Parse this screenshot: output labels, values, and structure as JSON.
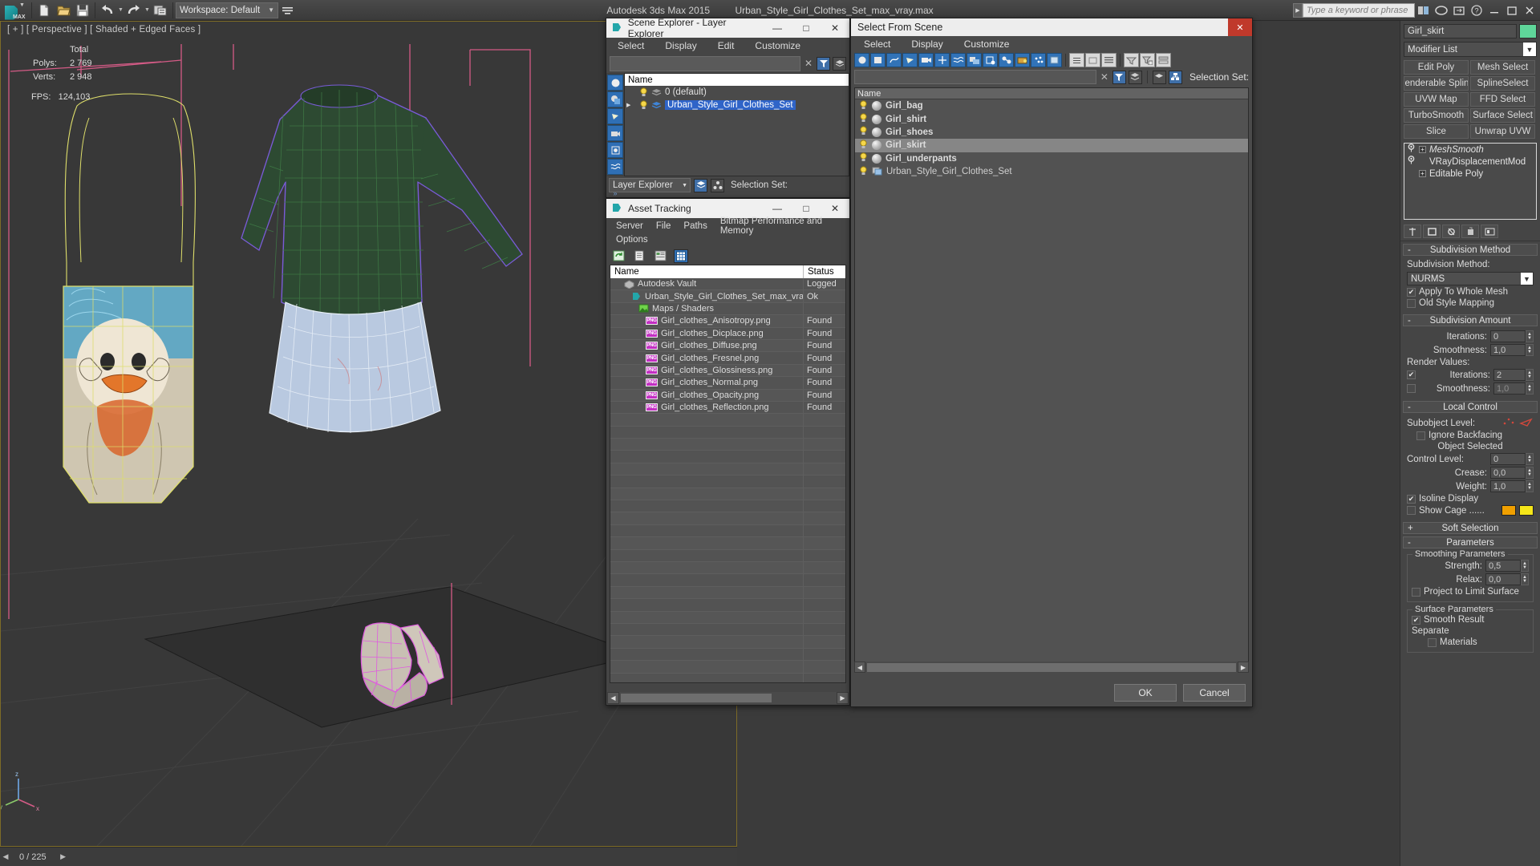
{
  "app": {
    "title_product": "Autodesk 3ds Max  2015",
    "title_file": "Urban_Style_Girl_Clothes_Set_max_vray.max",
    "workspace_label": "Workspace: Default",
    "search_placeholder": "Type a keyword or phrase",
    "logo_text": "MAX"
  },
  "viewport": {
    "label": "[ + ] [ Perspective ] [ Shaded + Edged Faces ]",
    "stats_header": "Total",
    "stats": [
      {
        "name": "Polys:",
        "value": "2 769"
      },
      {
        "name": "Verts:",
        "value": "2 948"
      }
    ],
    "fps_label": "FPS:",
    "fps_value": "124,103",
    "status_frame": "0 / 225"
  },
  "scene_explorer": {
    "title": "Scene Explorer - Layer Explorer",
    "menus": [
      "Select",
      "Display",
      "Edit",
      "Customize"
    ],
    "search_value": "",
    "header": "Name",
    "rows": [
      {
        "label": "0 (default)",
        "selected": false,
        "expandable": false
      },
      {
        "label": "Urban_Style_Girl_Clothes_Set",
        "selected": true,
        "expandable": true
      }
    ],
    "footer_combo": "Layer Explorer",
    "footer_selection_set": "Selection Set:"
  },
  "asset_tracking": {
    "title": "Asset Tracking",
    "menus": [
      "Server",
      "File",
      "Paths",
      "Bitmap Performance and Memory",
      "Options"
    ],
    "columns": [
      "Name",
      "Status"
    ],
    "rows": [
      {
        "name": "Autodesk Vault",
        "status": "Logged",
        "icon": "vault-icon",
        "indent": 1
      },
      {
        "name": "Urban_Style_Girl_Clothes_Set_max_vray.max",
        "status": "Ok",
        "icon": "max-icon",
        "indent": 2
      },
      {
        "name": "Maps / Shaders",
        "status": "",
        "icon": "maps-icon",
        "indent": 3
      },
      {
        "name": "Girl_clothes_Anisotropy.png",
        "status": "Found",
        "icon": "png-icon",
        "indent": 4
      },
      {
        "name": "Girl_clothes_Dicplace.png",
        "status": "Found",
        "icon": "png-icon",
        "indent": 4
      },
      {
        "name": "Girl_clothes_Diffuse.png",
        "status": "Found",
        "icon": "png-icon",
        "indent": 4
      },
      {
        "name": "Girl_clothes_Fresnel.png",
        "status": "Found",
        "icon": "png-icon",
        "indent": 4
      },
      {
        "name": "Girl_clothes_Glossiness.png",
        "status": "Found",
        "icon": "png-icon",
        "indent": 4
      },
      {
        "name": "Girl_clothes_Normal.png",
        "status": "Found",
        "icon": "png-icon",
        "indent": 4
      },
      {
        "name": "Girl_clothes_Opacity.png",
        "status": "Found",
        "icon": "png-icon",
        "indent": 4
      },
      {
        "name": "Girl_clothes_Reflection.png",
        "status": "Found",
        "icon": "png-icon",
        "indent": 4
      }
    ],
    "empty_row_count": 23
  },
  "select_from_scene": {
    "title": "Select From Scene",
    "menus": [
      "Select",
      "Display",
      "Customize"
    ],
    "search_value": "",
    "selection_set_label": "Selection Set:",
    "header": "Name",
    "rows": [
      {
        "label": "Girl_bag",
        "selected": false,
        "type": "object"
      },
      {
        "label": "Girl_shirt",
        "selected": false,
        "type": "object"
      },
      {
        "label": "Girl_shoes",
        "selected": false,
        "type": "object"
      },
      {
        "label": "Girl_skirt",
        "selected": true,
        "type": "object"
      },
      {
        "label": "Girl_underpants",
        "selected": false,
        "type": "object"
      },
      {
        "label": "Urban_Style_Girl_Clothes_Set",
        "selected": false,
        "type": "group"
      }
    ],
    "ok_label": "OK",
    "cancel_label": "Cancel"
  },
  "command_panel": {
    "object_name": "Girl_skirt",
    "object_color": "#5fd69a",
    "modifier_list_label": "Modifier List",
    "modifier_buttons": [
      "Edit Poly",
      "Mesh Select",
      "Renderable Spline",
      "SplineSelect",
      "UVW Map",
      "FFD Select",
      "TurboSmooth",
      "Surface Select",
      "Slice",
      "Unwrap UVW"
    ],
    "stack": [
      {
        "label": "MeshSmooth",
        "italic": true,
        "has_plus": true,
        "eye": true
      },
      {
        "label": "VRayDisplacementMod",
        "italic": false,
        "has_plus": false,
        "eye": true
      },
      {
        "label": "Editable Poly",
        "italic": false,
        "has_plus": true,
        "eye": false
      }
    ],
    "rollouts": {
      "subdivision_method": {
        "title": "Subdivision Method",
        "label": "Subdivision Method:",
        "value": "NURMS",
        "apply_whole_mesh": {
          "label": "Apply To Whole Mesh",
          "checked": true
        },
        "old_style_mapping": {
          "label": "Old Style Mapping",
          "checked": false
        }
      },
      "subdivision_amount": {
        "title": "Subdivision Amount",
        "iterations_label": "Iterations:",
        "iterations_value": "0",
        "smoothness_label": "Smoothness:",
        "smoothness_value": "1,0",
        "render_values_label": "Render Values:",
        "render_iterations_label": "Iterations:",
        "render_iterations_value": "2",
        "render_iterations_checked": true,
        "render_smoothness_label": "Smoothness:",
        "render_smoothness_value": "1,0",
        "render_smoothness_checked": false
      },
      "local_control": {
        "title": "Local Control",
        "subobject_label": "Subobject Level:",
        "ignore_backfacing": {
          "label": "Ignore Backfacing",
          "checked": false
        },
        "object_selected": "Object Selected",
        "control_level_label": "Control Level:",
        "control_level_value": "0",
        "crease_label": "Crease:",
        "crease_value": "0,0",
        "weight_label": "Weight:",
        "weight_value": "1,0",
        "isoline_display": {
          "label": "Isoline Display",
          "checked": true
        },
        "show_cage": {
          "label": "Show Cage ......",
          "checked": false,
          "color1": "#f0a000",
          "color2": "#f5e619"
        }
      },
      "soft_selection": {
        "title": "Soft Selection",
        "collapsed": true
      },
      "parameters": {
        "title": "Parameters",
        "smoothing_title": "Smoothing Parameters",
        "strength_label": "Strength:",
        "strength_value": "0,5",
        "relax_label": "Relax:",
        "relax_value": "0,0",
        "project_limit": {
          "label": "Project to Limit Surface",
          "checked": false
        },
        "surface_title": "Surface Parameters",
        "smooth_result": {
          "label": "Smooth Result",
          "checked": true
        },
        "separate_label": "Separate",
        "materials": {
          "label": "Materials",
          "checked": false
        }
      }
    }
  },
  "colors": {
    "accent_blue": "#2f6fb5",
    "selection_blue": "#2f64c8",
    "viewport_bg": "#383838",
    "panel_bg": "#454545"
  }
}
